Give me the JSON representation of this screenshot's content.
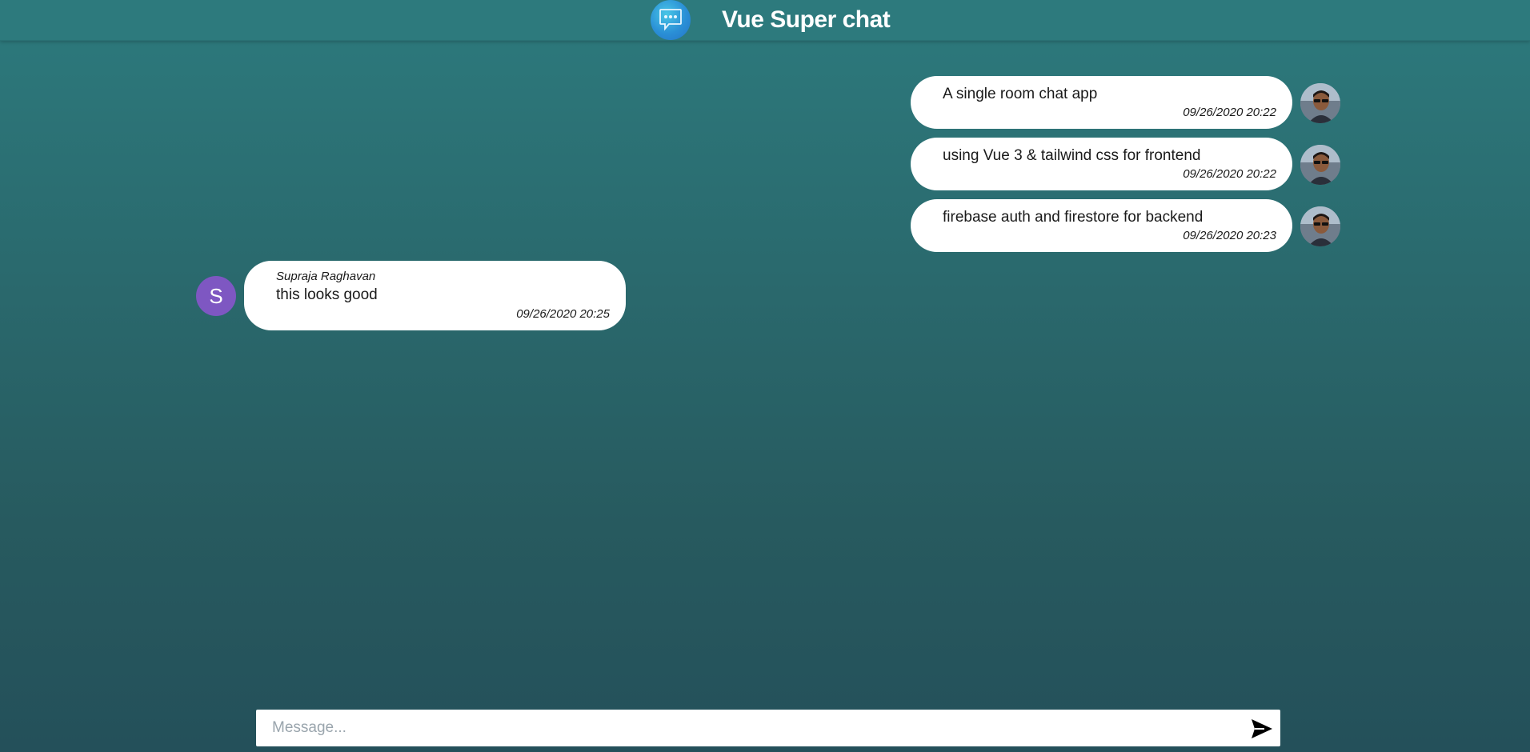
{
  "header": {
    "title": "Vue Super chat",
    "logo_icon": "chat-bubble-icon"
  },
  "messages": [
    {
      "text": "A single room chat app",
      "time": "09/26/2020 20:22",
      "side": "right"
    },
    {
      "text": "using Vue 3 & tailwind css for frontend",
      "time": "09/26/2020 20:22",
      "side": "right"
    },
    {
      "text": "firebase auth and firestore for backend",
      "time": "09/26/2020 20:23",
      "side": "right"
    },
    {
      "sender": "Supraja Raghavan",
      "avatar_letter": "S",
      "text": "this looks good",
      "time": "09/26/2020 20:25",
      "side": "left"
    }
  ],
  "composer": {
    "placeholder": "Message...",
    "value": "",
    "send_icon": "send-icon"
  },
  "colors": {
    "header": "#2d7a7d",
    "avatar_letter_bg": "#7e57c2",
    "bubble": "#ffffff"
  }
}
